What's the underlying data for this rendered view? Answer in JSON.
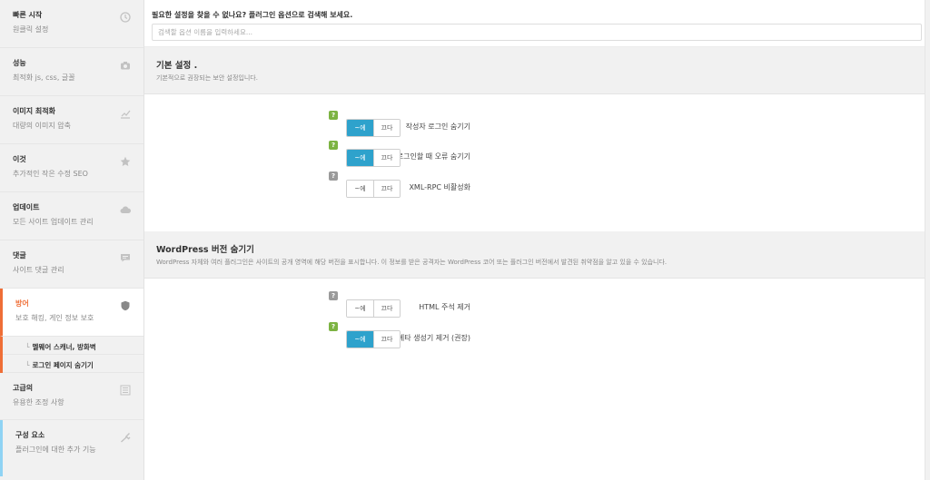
{
  "sidebar": {
    "items": [
      {
        "title": "빠른 시작",
        "sub": "원클릭 설정",
        "icon": "clock-icon"
      },
      {
        "title": "성능",
        "sub": "최적화 js, css, 글꼴",
        "icon": "camera-icon"
      },
      {
        "title": "이미지 최적화",
        "sub": "대량의 이미지 압축",
        "icon": "chart-icon"
      },
      {
        "title": "이것",
        "sub": "추가적인 작은 수정 SEO",
        "icon": "star-icon"
      },
      {
        "title": "업데이트",
        "sub": "모든 사이트 업데이트 관리",
        "icon": "cloud-icon"
      },
      {
        "title": "댓글",
        "sub": "사이트 댓글 관리",
        "icon": "comment-icon"
      },
      {
        "title": "방어",
        "sub": "보호 해킹, 게인 정보 보호",
        "icon": "shield-icon"
      },
      {
        "title": "고급의",
        "sub": "유용한 조정 사항",
        "icon": "list-icon"
      },
      {
        "title": "구성 요소",
        "sub": "플러그인에 대한 추가 기능",
        "icon": "wrench-icon"
      }
    ],
    "subitems": [
      "멜웨어 스캐너, 방화벽",
      "로그인 페이지 숨기기"
    ]
  },
  "search": {
    "label": "필요한 설정을 찾을 수 없나요? 플러그인 옵션으로 검색해 보세요.",
    "placeholder": "검색할 옵션 이름을 입력하세요..."
  },
  "sections": [
    {
      "title": "기본 설정 .",
      "desc": "기본적으로 권장되는 보안 설정입니다."
    },
    {
      "title": "WordPress 버전 숨기기",
      "desc": "WordPress 자체와 여러 플러그인은 사이트의 공개 영역에 해당 버전을 표시합니다. 이 정보를 받은 공격자는 WordPress 코어 또는 플러그인 버전에서 발견된 취약점을 알고 있을 수 있습니다."
    }
  ],
  "toggle": {
    "on": "~에",
    "off": "끄다"
  },
  "help_mark": "?",
  "options": [
    {
      "label": "작성자 로그인 숨기기",
      "state": "on",
      "help": "green"
    },
    {
      "label": "사이트에 로그인할 때 오류 숨기기",
      "state": "on",
      "help": "green"
    },
    {
      "label": "XML-RPC 비활성화",
      "state": "off",
      "help": "gray"
    },
    {
      "label": "HTML 주석 제거",
      "state": "off",
      "help": "gray"
    },
    {
      "label": "메타 생성기 제거 (권장)",
      "state": "on",
      "help": "green"
    }
  ],
  "colors": {
    "accent": "#2ea2cc",
    "active": "#ef6e36",
    "help_green": "#7cb342",
    "help_gray": "#9a9a9a"
  }
}
